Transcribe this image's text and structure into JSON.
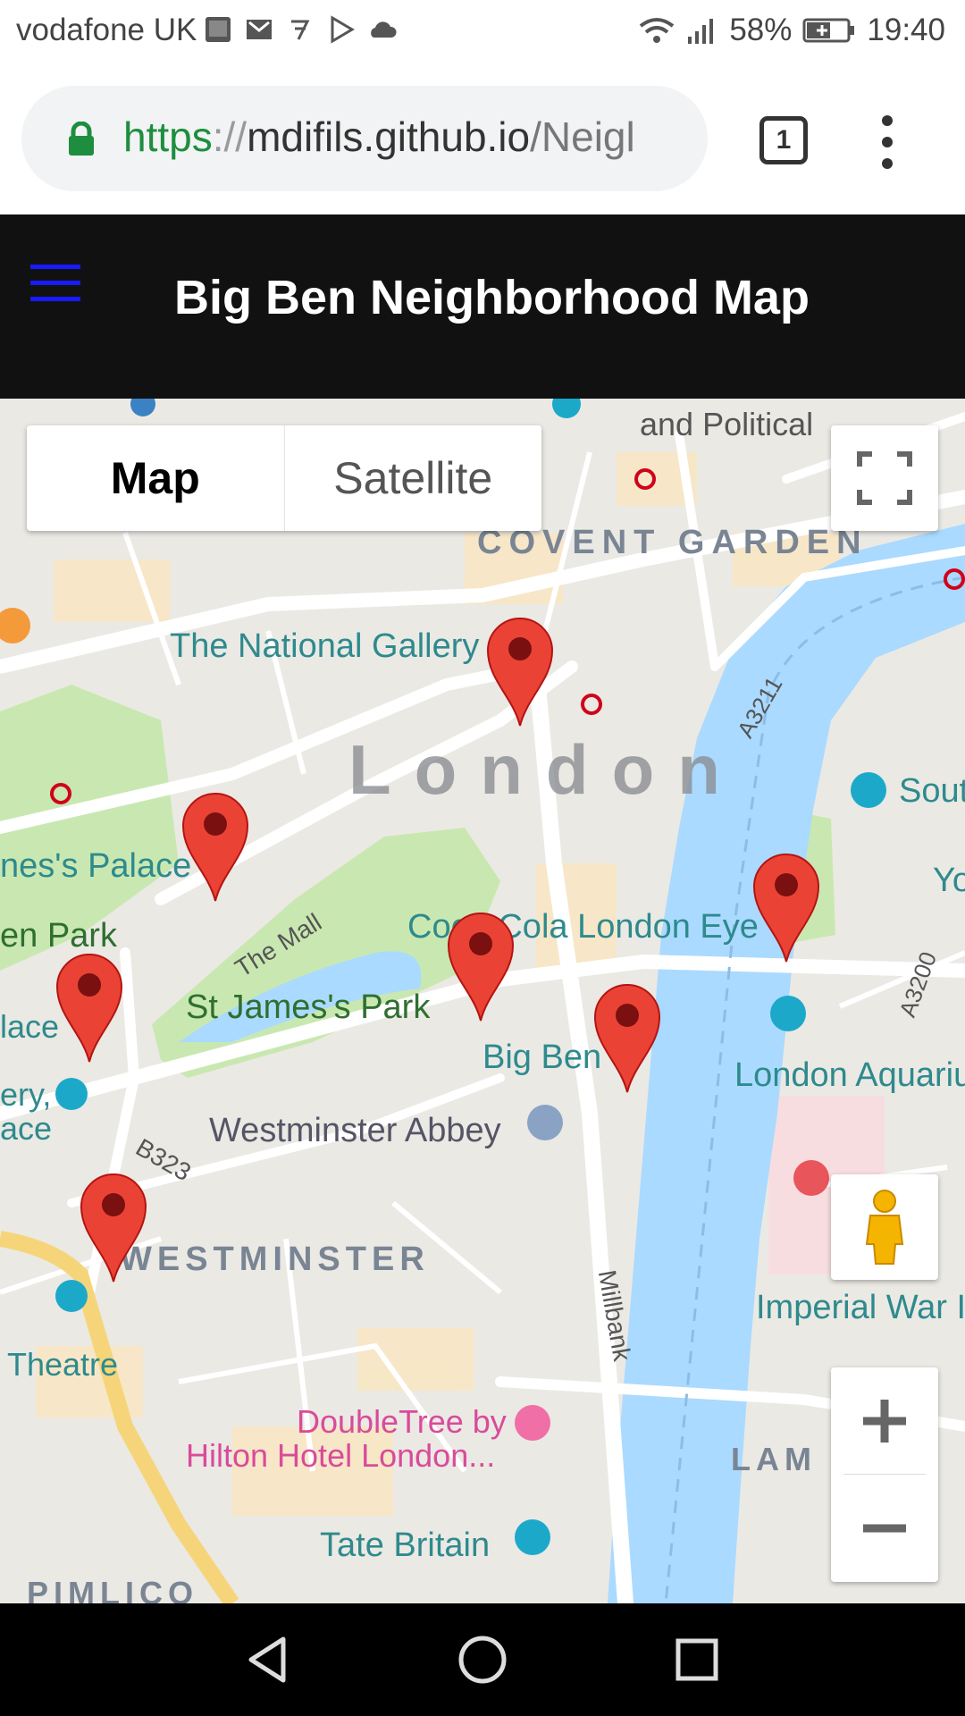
{
  "status_bar": {
    "carrier": "vodafone UK",
    "battery": "58%",
    "time": "19:40"
  },
  "browser": {
    "url_scheme": "https",
    "url_separator": "://",
    "url_host": "mdifils.github.io",
    "url_path": "/Neigl",
    "tab_count": "1"
  },
  "app": {
    "title": "Big Ben Neighborhood Map"
  },
  "map": {
    "type_control": {
      "map_label": "Map",
      "satellite_label": "Satellite"
    },
    "labels": {
      "political": "and Political",
      "covent_garden": "COVENT GARDEN",
      "national_gallery": "The National Gallery",
      "london": "London",
      "south": "Sout",
      "yo": "Yo",
      "palace": "nes's Palace",
      "green_park": "en Park",
      "lace": "lace",
      "ery": "ery,",
      "ace": "ace",
      "the_mall": "The Mall",
      "coca_cola": "Coca-Cola London Eye",
      "st_james": "St James's Park",
      "big_ben": "Big Ben",
      "aquarium": "London Aquariu",
      "westminster_abbey": "Westminster Abbey",
      "b323": "B323",
      "westminster": "WESTMINSTER",
      "theatre": "Theatre",
      "millbank": "Millbank",
      "imperial": "Imperial War I",
      "doubletree_1": "DoubleTree by",
      "doubletree_2": "Hilton Hotel London...",
      "lambeth": "LAM       H",
      "tate": "Tate Britain",
      "pimlico": "PIMLICO",
      "a3211": "A3211",
      "a3200": "A3200"
    }
  }
}
